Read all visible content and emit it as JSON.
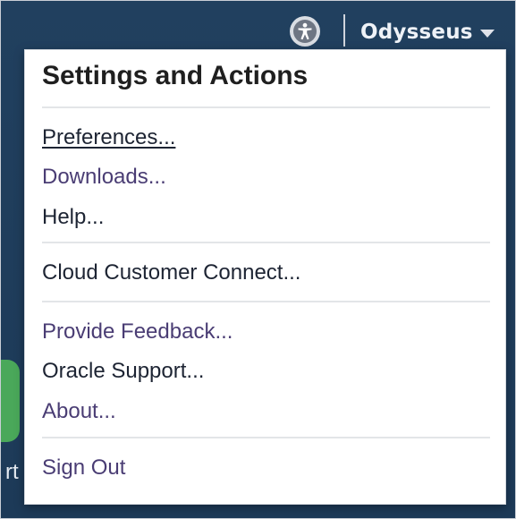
{
  "header": {
    "accessibility_icon": "accessibility-icon",
    "user_name": "Odysseus",
    "caret_icon": "chevron-down-icon"
  },
  "background": {
    "left_fragment_text": "rt"
  },
  "menu": {
    "title": "Settings and Actions",
    "groups": [
      {
        "items": [
          {
            "label": "Preferences...",
            "color": "#1d2433",
            "underlined": true
          },
          {
            "label": "Downloads...",
            "color": "#4a3d74"
          },
          {
            "label": "Help...",
            "color": "#1d2433"
          }
        ]
      },
      {
        "items": [
          {
            "label": "Cloud Customer Connect...",
            "color": "#1d2433"
          }
        ]
      },
      {
        "items": [
          {
            "label": "Provide Feedback...",
            "color": "#4a3d74"
          },
          {
            "label": "Oracle Support...",
            "color": "#1d2433"
          },
          {
            "label": "About...",
            "color": "#4a3d74"
          }
        ]
      },
      {
        "items": [
          {
            "label": "Sign Out",
            "color": "#4a3d74"
          }
        ]
      }
    ]
  },
  "colors": {
    "page_background": "#1f3a5c",
    "popup_background": "#ffffff",
    "separator": "#e3e5e8",
    "accent_green": "#4aa85a"
  }
}
